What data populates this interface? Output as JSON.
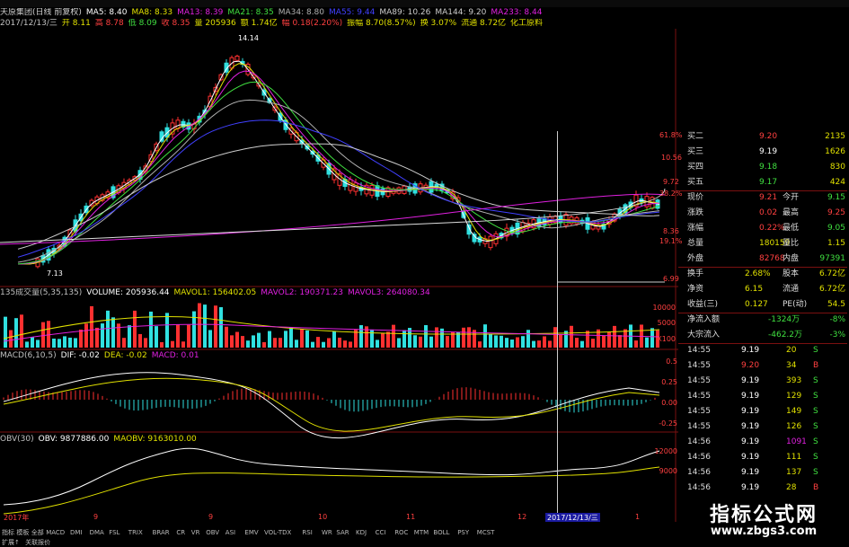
{
  "header": {
    "line1": [
      {
        "text": "天原集团(日线 前复权)",
        "color": "#d0d0d0"
      },
      {
        "text": "MA5: 8.40",
        "color": "#ffffff"
      },
      {
        "text": "MA8: 8.33",
        "color": "#e0e000"
      },
      {
        "text": "MA13: 8.39",
        "color": "#e020e0"
      },
      {
        "text": "MA21: 8.35",
        "color": "#40e040"
      },
      {
        "text": "MA34: 8.80",
        "color": "#b0b0b0"
      },
      {
        "text": "MA55: 9.44",
        "color": "#4040ff"
      },
      {
        "text": "MA89: 10.26",
        "color": "#cccccc"
      },
      {
        "text": "MA144: 9.20",
        "color": "#cccccc"
      },
      {
        "text": "MA233: 8.44",
        "color": "#e020e0"
      }
    ],
    "line2": [
      {
        "text": "2017/12/13/三",
        "color": "#c0c0c0"
      },
      {
        "text": "开 8.11",
        "color": "#e0e000"
      },
      {
        "text": "高 8.78",
        "color": "#ff4040"
      },
      {
        "text": "低 8.09",
        "color": "#40e040"
      },
      {
        "text": "收 8.35",
        "color": "#ff4040"
      },
      {
        "text": "量 205936",
        "color": "#e0e000"
      },
      {
        "text": "额 1.74亿",
        "color": "#e0e000"
      },
      {
        "text": "幅 0.18(2.20%)",
        "color": "#ff4040"
      },
      {
        "text": "振幅 8.70(8.57%)",
        "color": "#e0e000"
      },
      {
        "text": "换 3.07%",
        "color": "#e0e000"
      },
      {
        "text": "流通 8.72亿",
        "color": "#e0e000"
      },
      {
        "text": "化工原料",
        "color": "#e0e000"
      }
    ]
  },
  "price_axis": {
    "right": [
      "61.8%",
      "10.56",
      "9.72",
      "38.2%",
      "8.36",
      "19.1%",
      "6.99"
    ],
    "peak_label": "14.14",
    "low_label": "7.13"
  },
  "volume_panel": {
    "legend": [
      {
        "text": "135成交量(5,35,135)",
        "color": "#c0c0c0"
      },
      {
        "text": "VOLUME: 205936.44",
        "color": "#ffffff"
      },
      {
        "text": "MAVOL1: 156402.05",
        "color": "#e0e000"
      },
      {
        "text": "MAVOL2: 190371.23",
        "color": "#e020e0"
      },
      {
        "text": "MAVOL3: 264080.34",
        "color": "#e020e0"
      }
    ],
    "axis": [
      "10000",
      "5000",
      "X100"
    ]
  },
  "macd_panel": {
    "legend": [
      {
        "text": "MACD(6,10,5)",
        "color": "#c0c0c0"
      },
      {
        "text": "DIF: -0.02",
        "color": "#ffffff"
      },
      {
        "text": "DEA: -0.02",
        "color": "#e0e000"
      },
      {
        "text": "MACD: 0.01",
        "color": "#e020e0"
      }
    ],
    "axis": [
      "0.5",
      "0.25",
      "0.00",
      "-0.25"
    ]
  },
  "obv_panel": {
    "legend": [
      {
        "text": "OBV(30)",
        "color": "#c0c0c0"
      },
      {
        "text": "OBV: 9877886.00",
        "color": "#ffffff"
      },
      {
        "text": "MAOBV: 9163010.00",
        "color": "#e0e000"
      }
    ],
    "axis": [
      "12000",
      "9000"
    ]
  },
  "date_axis": {
    "labels": [
      "2017年",
      "9",
      "9",
      "10",
      "11",
      "12",
      "1"
    ],
    "cursor_date": "2017/12/13/三"
  },
  "order_book": [
    {
      "label": "买二",
      "price": "9.20",
      "vol": "2135",
      "pcolor": "#ff4040"
    },
    {
      "label": "买三",
      "price": "9.19",
      "vol": "1626",
      "pcolor": "#ffffff"
    },
    {
      "label": "买四",
      "price": "9.18",
      "vol": "830",
      "pcolor": "#40e040"
    },
    {
      "label": "买五",
      "price": "9.17",
      "vol": "424",
      "pcolor": "#40e040"
    }
  ],
  "quote": [
    {
      "l1": "现价",
      "v1": "9.21",
      "l2": "今开",
      "v2": "9.15",
      "c1": "#ff4040",
      "c2": "#40e040"
    },
    {
      "l1": "涨跌",
      "v1": "0.02",
      "l2": "最高",
      "v2": "9.25",
      "c1": "#ff4040",
      "c2": "#ff4040"
    },
    {
      "l1": "涨幅",
      "v1": "0.22%",
      "l2": "最低",
      "v2": "9.05",
      "c1": "#ff4040",
      "c2": "#40e040"
    },
    {
      "l1": "总量",
      "v1": "180159",
      "l2": "量比",
      "v2": "1.15",
      "c1": "#e0e000",
      "c2": "#e0e000"
    },
    {
      "l1": "外盘",
      "v1": "82768",
      "l2": "内盘",
      "v2": "97391",
      "c1": "#ff4040",
      "c2": "#40e040"
    }
  ],
  "stats": [
    {
      "l1": "换手",
      "v1": "2.68%",
      "l2": "股本",
      "v2": "6.72亿"
    },
    {
      "l1": "净资",
      "v1": "6.15",
      "l2": "流通",
      "v2": "6.72亿"
    },
    {
      "l1": "收益(三)",
      "v1": "0.127",
      "l2": "PE(动)",
      "v2": "54.5"
    }
  ],
  "flows": [
    {
      "label": "净流入额",
      "value": "-1324万",
      "pct": "-8%"
    },
    {
      "label": "大宗流入",
      "value": "-462.2万",
      "pct": "-3%"
    }
  ],
  "ticks": [
    {
      "time": "14:55",
      "price": "9.19",
      "vol": "20",
      "side": "S",
      "pc": "#ffffff",
      "vc": "#e0e000",
      "sc": "#40e040"
    },
    {
      "time": "14:55",
      "price": "9.20",
      "vol": "34",
      "side": "B",
      "pc": "#ff4040",
      "vc": "#e0e000",
      "sc": "#ff4040"
    },
    {
      "time": "14:55",
      "price": "9.19",
      "vol": "393",
      "side": "S",
      "pc": "#ffffff",
      "vc": "#e0e000",
      "sc": "#40e040"
    },
    {
      "time": "14:55",
      "price": "9.19",
      "vol": "129",
      "side": "S",
      "pc": "#ffffff",
      "vc": "#e0e000",
      "sc": "#40e040"
    },
    {
      "time": "14:55",
      "price": "9.19",
      "vol": "149",
      "side": "S",
      "pc": "#ffffff",
      "vc": "#e0e000",
      "sc": "#40e040"
    },
    {
      "time": "14:55",
      "price": "9.19",
      "vol": "126",
      "side": "S",
      "pc": "#ffffff",
      "vc": "#e0e000",
      "sc": "#40e040"
    },
    {
      "time": "14:56",
      "price": "9.19",
      "vol": "1091",
      "side": "S",
      "pc": "#ffffff",
      "vc": "#e020e0",
      "sc": "#40e040"
    },
    {
      "time": "14:56",
      "price": "9.19",
      "vol": "111",
      "side": "S",
      "pc": "#ffffff",
      "vc": "#e0e000",
      "sc": "#40e040"
    },
    {
      "time": "14:56",
      "price": "9.19",
      "vol": "137",
      "side": "S",
      "pc": "#ffffff",
      "vc": "#e0e000",
      "sc": "#40e040"
    },
    {
      "time": "14:56",
      "price": "9.19",
      "vol": "28",
      "side": "B",
      "pc": "#ffffff",
      "vc": "#e0e000",
      "sc": "#ff4040"
    },
    {
      "time": "14:56",
      "price": "9.20",
      "vol": "3",
      "side": "B",
      "pc": "#ff4040",
      "vc": "#e0e000",
      "sc": "#ff4040"
    }
  ],
  "tabs": [
    "指标",
    "模板",
    "全部",
    "MACD",
    "DMI",
    "DMA",
    "FSL",
    "TRIX",
    "BRAR",
    "CR",
    "VR",
    "OBV",
    "ASI",
    "EMV",
    "VOL-TDX",
    "RSI",
    "WR",
    "SAR",
    "KDJ",
    "CCI",
    "ROC",
    "MTM",
    "BOLL",
    "PSY",
    "MCST"
  ],
  "bottom_status": [
    "扩展↑",
    "关联报价"
  ],
  "brand": {
    "title": "指标公式网",
    "url": "www.zbgs3.com"
  }
}
